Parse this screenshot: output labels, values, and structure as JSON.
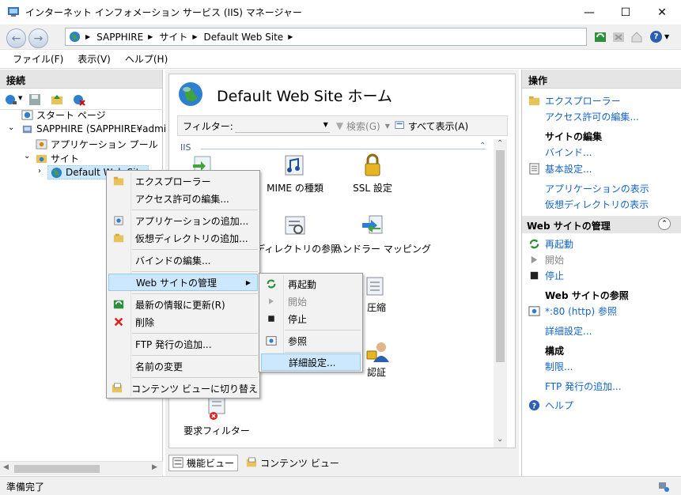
{
  "window": {
    "title": "インターネット インフォメーション サービス (IIS) マネージャー",
    "min": "—",
    "max": "☐",
    "close": "✕"
  },
  "address": {
    "segments": [
      "SAPPHIRE",
      "サイト",
      "Default Web Site"
    ],
    "help": "?"
  },
  "menubar": {
    "file": "ファイル(F)",
    "view": "表示(V)",
    "help": "ヘルプ(H)"
  },
  "left": {
    "header": "接続",
    "tree": {
      "start": "スタート ページ",
      "server": "SAPPHIRE (SAPPHIRE¥admink",
      "apppools": "アプリケーション プール",
      "sites": "サイト",
      "site": "Default Web Site"
    }
  },
  "center": {
    "title": "Default Web Site ホーム",
    "filter_label": "フィルター:",
    "search": "検索(G)",
    "show_all": "すべて表示(A)",
    "group": "IIS",
    "features": {
      "mime": "MIME の種類",
      "ssl": "SSL 設定",
      "dirbrowse": "ディレクトリの参照",
      "handlers": "ハンドラー マッピング",
      "compression": "圧縮",
      "auth": "認証",
      "reqfilter": "要求フィルター"
    },
    "tabs": {
      "features": "機能ビュー",
      "content": "コンテンツ ビュー"
    }
  },
  "right": {
    "header": "操作",
    "explore": "エクスプローラー",
    "edit_perm": "アクセス許可の編集...",
    "edit_site": "サイトの編集",
    "bindings": "バインド...",
    "basic": "基本設定...",
    "view_apps": "アプリケーションの表示",
    "view_vdirs": "仮想ディレクトリの表示",
    "manage_head": "Web サイトの管理",
    "restart": "再起動",
    "start": "開始",
    "stop": "停止",
    "browse_head": "Web サイトの参照",
    "browse_80": "*:80 (http) 参照",
    "advanced": "詳細設定...",
    "config_head": "構成",
    "limits": "制限...",
    "add_ftp": "FTP 発行の追加...",
    "help": "ヘルプ"
  },
  "status": {
    "text": "準備完了"
  },
  "context_menu": {
    "explore": "エクスプローラー",
    "edit_perm": "アクセス許可の編集...",
    "add_app": "アプリケーションの追加...",
    "add_vdir": "仮想ディレクトリの追加...",
    "edit_bind": "バインドの編集...",
    "manage": "Web サイトの管理",
    "refresh": "最新の情報に更新(R)",
    "remove": "削除",
    "add_ftp": "FTP 発行の追加...",
    "rename": "名前の変更",
    "switch_content": "コンテンツ ビューに切り替え"
  },
  "submenu": {
    "restart": "再起動",
    "start": "開始",
    "stop": "停止",
    "browse": "参照",
    "advanced": "詳細設定..."
  }
}
